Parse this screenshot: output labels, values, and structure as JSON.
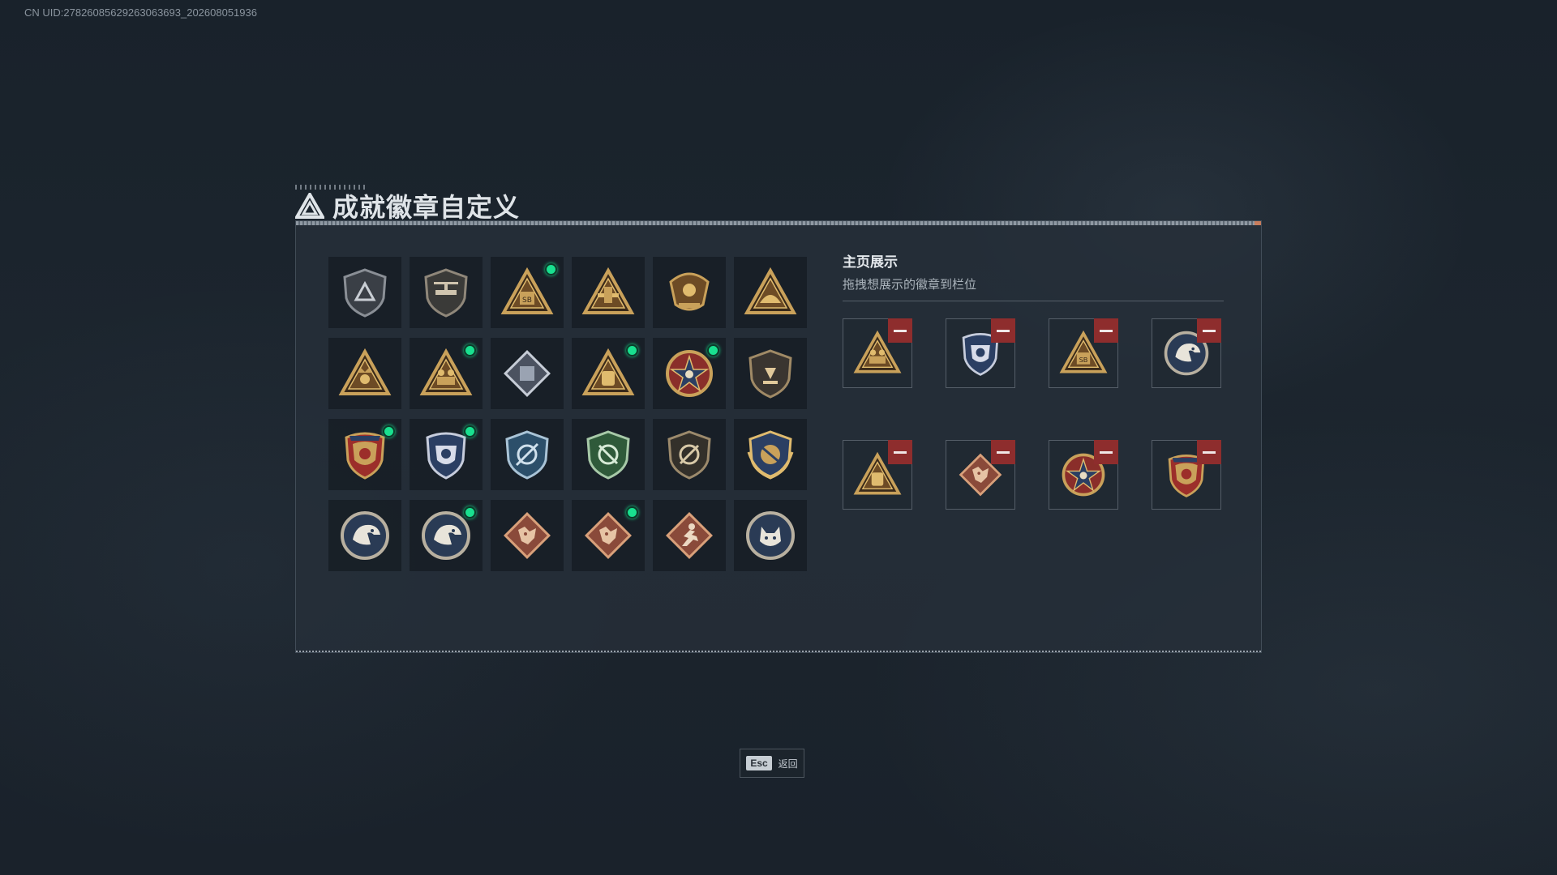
{
  "uid_text": "CN UID:27826085629263063693_202608051936",
  "title": "成就徽章自定义",
  "showcase": {
    "title": "主页展示",
    "subtitle": "拖拽想展示的徽章到栏位"
  },
  "colors": {
    "gold": "#c9a15a",
    "navy": "#2b3f63",
    "green_dot": "#19e08f",
    "remove_red": "#8e2d2d",
    "rust": "#8a4a3a"
  },
  "badges": [
    {
      "icon": "tri-shield-icon",
      "new": false
    },
    {
      "icon": "helicopter-shield-icon",
      "new": false
    },
    {
      "icon": "sb-triangle-icon",
      "new": true
    },
    {
      "icon": "structure-triangle-icon",
      "new": false
    },
    {
      "icon": "eagle-crest-icon",
      "new": false
    },
    {
      "icon": "tent-triangle-icon",
      "new": false
    },
    {
      "icon": "crown-triangle-icon",
      "new": false
    },
    {
      "icon": "soldiers-triangle-icon",
      "new": true
    },
    {
      "icon": "cube-diamond-icon",
      "new": false
    },
    {
      "icon": "pack-triangle-icon",
      "new": true
    },
    {
      "icon": "skull-star-icon",
      "new": true
    },
    {
      "icon": "emblem-shield-icon",
      "new": false
    },
    {
      "icon": "red-star-shield-icon",
      "new": true
    },
    {
      "icon": "blue-shield-icon",
      "new": true
    },
    {
      "icon": "blue-target-shield-icon",
      "new": false
    },
    {
      "icon": "green-target-shield-icon",
      "new": false
    },
    {
      "icon": "dark-target-shield-icon",
      "new": false
    },
    {
      "icon": "gold-laurel-shield-icon",
      "new": false
    },
    {
      "icon": "eagle-medallion-icon",
      "new": false
    },
    {
      "icon": "eagle-medallion-icon",
      "new": true
    },
    {
      "icon": "dragon-diamond-icon",
      "new": false
    },
    {
      "icon": "dragon-diamond-icon",
      "new": true
    },
    {
      "icon": "runner-diamond-icon",
      "new": false
    },
    {
      "icon": "wolf-medallion-icon",
      "new": false
    }
  ],
  "slots": [
    {
      "icon": "soldiers-triangle-icon"
    },
    {
      "icon": "blue-shield-icon"
    },
    {
      "icon": "sb-triangle-icon"
    },
    {
      "icon": "eagle-medallion-icon"
    },
    {
      "icon": "pack-triangle-icon"
    },
    {
      "icon": "dragon-diamond-icon"
    },
    {
      "icon": "skull-star-icon"
    },
    {
      "icon": "red-star-shield-icon"
    }
  ],
  "esc": {
    "key": "Esc",
    "label": "返回"
  }
}
